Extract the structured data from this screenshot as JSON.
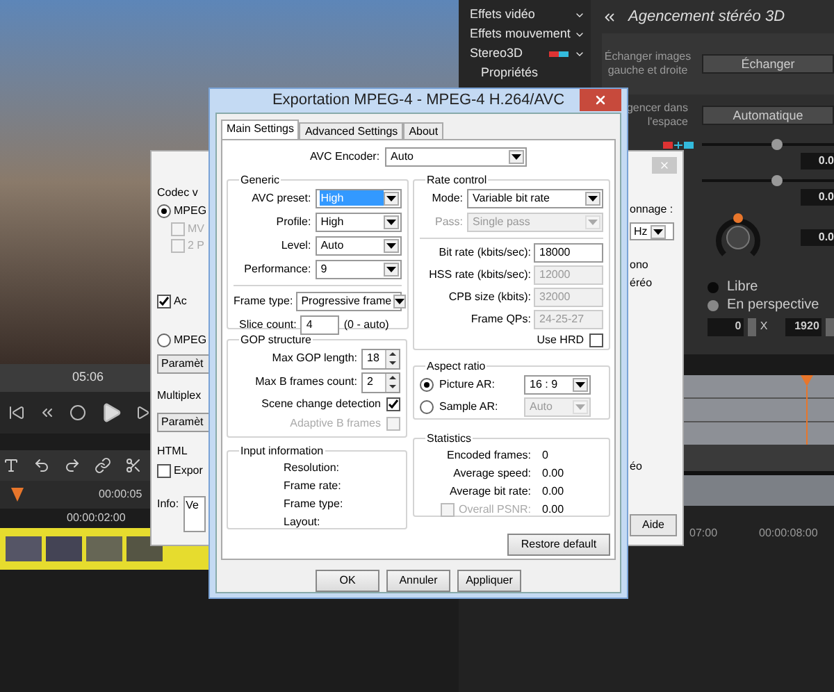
{
  "editor": {
    "timecode": "05:06",
    "ruler_label": "00:00:05",
    "clip_label": "00:00:02:00",
    "right_ruler": [
      "07:00",
      "00:00:08:00"
    ]
  },
  "effects_menu": [
    {
      "label": "Effets vidéo",
      "kind": "group"
    },
    {
      "label": "Effets mouvement",
      "kind": "group"
    },
    {
      "label": "Stereo3D",
      "kind": "stereo"
    },
    {
      "label": "Propriétés",
      "kind": "sub"
    }
  ],
  "stereo_panel": {
    "title": "Agencement stéréo 3D",
    "swap_label": "Échanger images gauche et droite",
    "swap_button": "Échanger",
    "arrange_label": [
      "gencer dans",
      "l'espace"
    ],
    "auto_button": "Automatique",
    "sliders": [
      {
        "level": 0.57,
        "reading": "0.0"
      },
      {
        "level": 0.57,
        "reading": "0.0"
      }
    ],
    "dial_reading": "0.0",
    "modes": [
      {
        "label": "Libre",
        "selected": true
      },
      {
        "label": "En perspective",
        "selected": false
      }
    ],
    "x_value": "0",
    "x_unit": "X",
    "width_value": "1920"
  },
  "back_dialog": {
    "left": [
      {
        "kind": "group",
        "label": "Codec v"
      },
      {
        "kind": "radio",
        "label": "MPEG",
        "selected": true
      },
      {
        "kind": "check",
        "label": "MV",
        "checked": false,
        "disabled": true
      },
      {
        "kind": "check",
        "label": "2 P",
        "checked": false,
        "disabled": true
      },
      {
        "kind": "check",
        "label": "Ac",
        "checked": true,
        "disabled": false
      },
      {
        "kind": "radio",
        "label": "MPEG",
        "selected": false
      },
      {
        "kind": "button",
        "label": "Paramèt"
      },
      {
        "kind": "group",
        "label": "Multiplex"
      },
      {
        "kind": "button",
        "label": "Paramèt"
      },
      {
        "kind": "group",
        "label": "HTML"
      },
      {
        "kind": "check",
        "label": "Expor",
        "checked": false,
        "disabled": false
      },
      {
        "kind": "info",
        "label": "Info:",
        "value": "Ve"
      }
    ],
    "right": [
      {
        "kind": "text",
        "label": "onnage :"
      },
      {
        "kind": "select",
        "label": "Hz"
      },
      {
        "kind": "text",
        "label": "ono"
      },
      {
        "kind": "text",
        "label": "éréo"
      },
      {
        "kind": "text",
        "label": "éo"
      },
      {
        "kind": "button",
        "label": "Aide"
      }
    ]
  },
  "dialog": {
    "title": "Exportation MPEG-4 - MPEG-4 H.264/AVC",
    "tabs": [
      {
        "label": "Main Settings",
        "selected": true
      },
      {
        "label": "Advanced Settings",
        "selected": false
      },
      {
        "label": "About",
        "selected": false
      }
    ],
    "encoder": {
      "label": "AVC Encoder:",
      "value": "Auto"
    },
    "generic": {
      "title": "Generic",
      "fields": [
        {
          "label": "AVC preset:",
          "value": "High",
          "selected": true
        },
        {
          "label": "Profile:",
          "value": "High",
          "selected": false
        },
        {
          "label": "Level:",
          "value": "Auto",
          "selected": false
        },
        {
          "label": "Performance:",
          "value": "9",
          "selected": false
        }
      ],
      "frame_type": {
        "label": "Frame type:",
        "value": "Progressive frame"
      },
      "slice": {
        "label": "Slice count:",
        "value": "4",
        "hint": "(0 - auto)"
      }
    },
    "gop": {
      "title": "GOP structure",
      "spinners": [
        {
          "label": "Max GOP length:",
          "value": "18"
        },
        {
          "label": "Max B frames count:",
          "value": "2"
        }
      ],
      "checks": [
        {
          "label": "Scene change detection",
          "checked": true,
          "disabled": false
        },
        {
          "label": "Adaptive B frames",
          "checked": false,
          "disabled": true
        }
      ]
    },
    "input_info": {
      "title": "Input information",
      "rows": [
        "Resolution:",
        "Frame rate:",
        "Frame type:",
        "Layout:"
      ]
    },
    "rate": {
      "title": "Rate control",
      "selects": [
        {
          "label": "Mode:",
          "value": "Variable bit rate",
          "disabled": false
        },
        {
          "label": "Pass:",
          "value": "Single pass",
          "disabled": true
        }
      ],
      "fields": [
        {
          "label": "Bit rate (kbits/sec):",
          "value": "18000",
          "disabled": false
        },
        {
          "label": "HSS rate (kbits/sec):",
          "value": "12000",
          "disabled": true
        },
        {
          "label": "CPB size (kbits):",
          "value": "32000",
          "disabled": true
        },
        {
          "label": "Frame QPs:",
          "value": "24-25-27",
          "disabled": true
        }
      ],
      "hrd": {
        "label": "Use HRD",
        "checked": false
      }
    },
    "aspect": {
      "title": "Aspect ratio",
      "options": [
        {
          "label": "Picture AR:",
          "value": "16 : 9",
          "selected": true
        },
        {
          "label": "Sample AR:",
          "value": "Auto",
          "selected": false
        }
      ]
    },
    "stats": {
      "title": "Statistics",
      "rows": [
        {
          "label": "Encoded frames:",
          "value": "0"
        },
        {
          "label": "Average speed:",
          "value": "0.00"
        },
        {
          "label": "Average bit rate:",
          "value": "0.00"
        }
      ],
      "psnr": {
        "label": "Overall PSNR:",
        "value": "0.00",
        "checked": false,
        "disabled": true
      }
    },
    "restore": "Restore default",
    "buttons": [
      "OK",
      "Annuler",
      "Appliquer"
    ]
  }
}
